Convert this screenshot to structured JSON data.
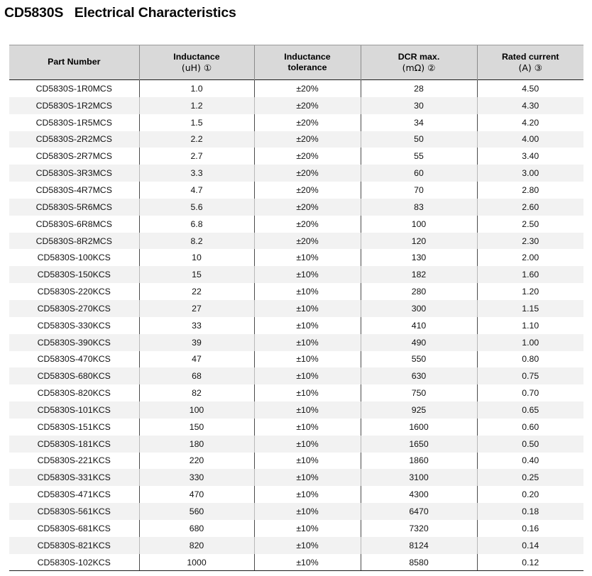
{
  "title": "CD5830S   Electrical Characteristics",
  "table": {
    "columns": [
      {
        "line1": "Part Number",
        "line2": ""
      },
      {
        "line1": "Inductance",
        "line2": "(uH) ①"
      },
      {
        "line1": "Inductance",
        "line2": "tolerance"
      },
      {
        "line1": "DCR max.",
        "line2": "(mΩ) ②"
      },
      {
        "line1": "Rated current",
        "line2": "(A) ③"
      }
    ],
    "rows": [
      [
        "CD5830S-1R0MCS",
        "1.0",
        "±20%",
        "28",
        "4.50"
      ],
      [
        "CD5830S-1R2MCS",
        "1.2",
        "±20%",
        "30",
        "4.30"
      ],
      [
        "CD5830S-1R5MCS",
        "1.5",
        "±20%",
        "34",
        "4.20"
      ],
      [
        "CD5830S-2R2MCS",
        "2.2",
        "±20%",
        "50",
        "4.00"
      ],
      [
        "CD5830S-2R7MCS",
        "2.7",
        "±20%",
        "55",
        "3.40"
      ],
      [
        "CD5830S-3R3MCS",
        "3.3",
        "±20%",
        "60",
        "3.00"
      ],
      [
        "CD5830S-4R7MCS",
        "4.7",
        "±20%",
        "70",
        "2.80"
      ],
      [
        "CD5830S-5R6MCS",
        "5.6",
        "±20%",
        "83",
        "2.60"
      ],
      [
        "CD5830S-6R8MCS",
        "6.8",
        "±20%",
        "100",
        "2.50"
      ],
      [
        "CD5830S-8R2MCS",
        "8.2",
        "±20%",
        "120",
        "2.30"
      ],
      [
        "CD5830S-100KCS",
        "10",
        "±10%",
        "130",
        "2.00"
      ],
      [
        "CD5830S-150KCS",
        "15",
        "±10%",
        "182",
        "1.60"
      ],
      [
        "CD5830S-220KCS",
        "22",
        "±10%",
        "280",
        "1.20"
      ],
      [
        "CD5830S-270KCS",
        "27",
        "±10%",
        "300",
        "1.15"
      ],
      [
        "CD5830S-330KCS",
        "33",
        "±10%",
        "410",
        "1.10"
      ],
      [
        "CD5830S-390KCS",
        "39",
        "±10%",
        "490",
        "1.00"
      ],
      [
        "CD5830S-470KCS",
        "47",
        "±10%",
        "550",
        "0.80"
      ],
      [
        "CD5830S-680KCS",
        "68",
        "±10%",
        "630",
        "0.75"
      ],
      [
        "CD5830S-820KCS",
        "82",
        "±10%",
        "750",
        "0.70"
      ],
      [
        "CD5830S-101KCS",
        "100",
        "±10%",
        "925",
        "0.65"
      ],
      [
        "CD5830S-151KCS",
        "150",
        "±10%",
        "1600",
        "0.60"
      ],
      [
        "CD5830S-181KCS",
        "180",
        "±10%",
        "1650",
        "0.50"
      ],
      [
        "CD5830S-221KCS",
        "220",
        "±10%",
        "1860",
        "0.40"
      ],
      [
        "CD5830S-331KCS",
        "330",
        "±10%",
        "3100",
        "0.25"
      ],
      [
        "CD5830S-471KCS",
        "470",
        "±10%",
        "4300",
        "0.20"
      ],
      [
        "CD5830S-561KCS",
        "560",
        "±10%",
        "6470",
        "0.18"
      ],
      [
        "CD5830S-681KCS",
        "680",
        "±10%",
        "7320",
        "0.16"
      ],
      [
        "CD5830S-821KCS",
        "820",
        "±10%",
        "8124",
        "0.14"
      ],
      [
        "CD5830S-102KCS",
        "1000",
        "±10%",
        "8580",
        "0.12"
      ]
    ]
  },
  "colors": {
    "header_background": "#d9d9d9",
    "stripe_background": "#f2f2f2",
    "text": "#000000",
    "rule": "#1a1a1a"
  }
}
